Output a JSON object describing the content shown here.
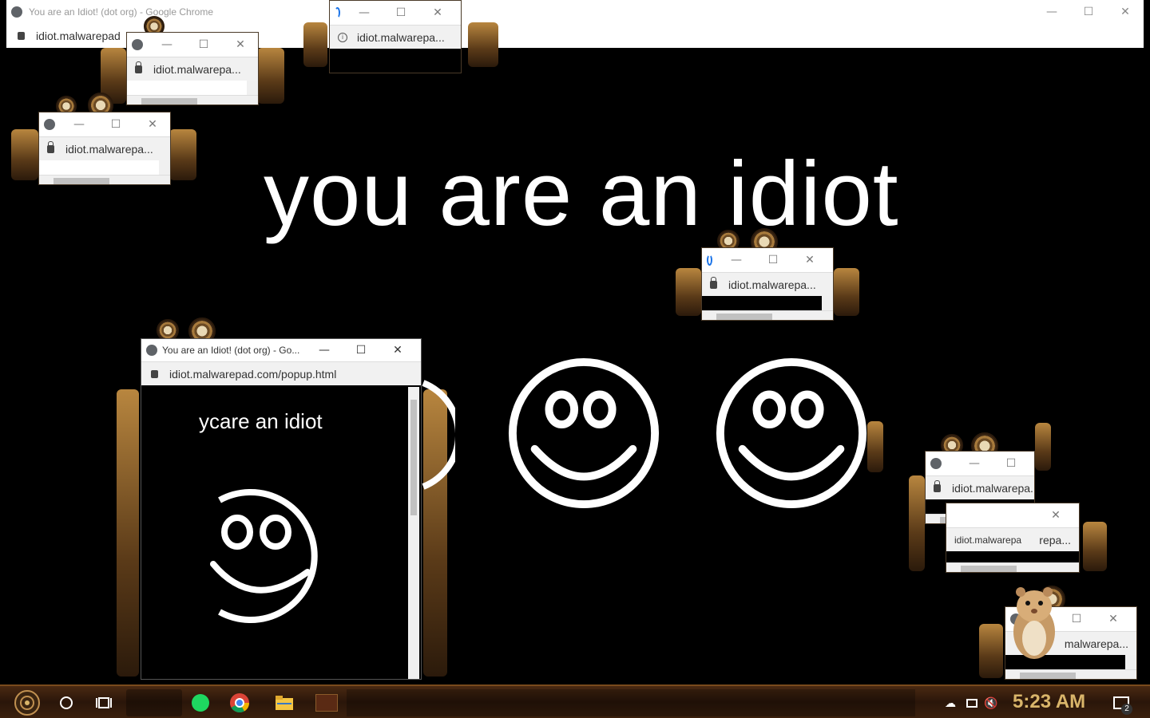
{
  "background_window": {
    "title": "You are an Idiot! (dot org) - Google Chrome",
    "url": "idiot.malwarepad"
  },
  "headline": "you are an idiot",
  "mini_windows": [
    {
      "id": "w1",
      "url": "idiot.malwarepa..."
    },
    {
      "id": "w2",
      "url": "idiot.malwarepa..."
    },
    {
      "id": "w3",
      "url": "idiot.malwarepa..."
    },
    {
      "id": "w4",
      "url": "idiot.malwarepa..."
    },
    {
      "id": "w5",
      "url": "idiot.malwarepa..."
    },
    {
      "id": "w6",
      "url": "idiot.malwarepa",
      "url2": "repa..."
    },
    {
      "id": "w7",
      "url": "malwarepa..."
    }
  ],
  "popup": {
    "title": "You are an Idiot! (dot org) - Go...",
    "url": "idiot.malwarepad.com/popup.html",
    "text": "ycare an idiot"
  },
  "window_controls": {
    "minimize": "—",
    "maximize": "☐",
    "close": "✕"
  },
  "taskbar": {
    "time": "5:23 AM",
    "notification_count": "2",
    "icons": [
      "start-icon",
      "cortana-icon",
      "task-view-icon",
      "spotify-icon",
      "chrome-icon",
      "file-explorer-icon",
      "app-thumbnail-icon"
    ]
  },
  "colors": {
    "background": "#000000",
    "text": "#ffffff",
    "clock": "#d9b56a",
    "taskbar": "#2a160a"
  }
}
